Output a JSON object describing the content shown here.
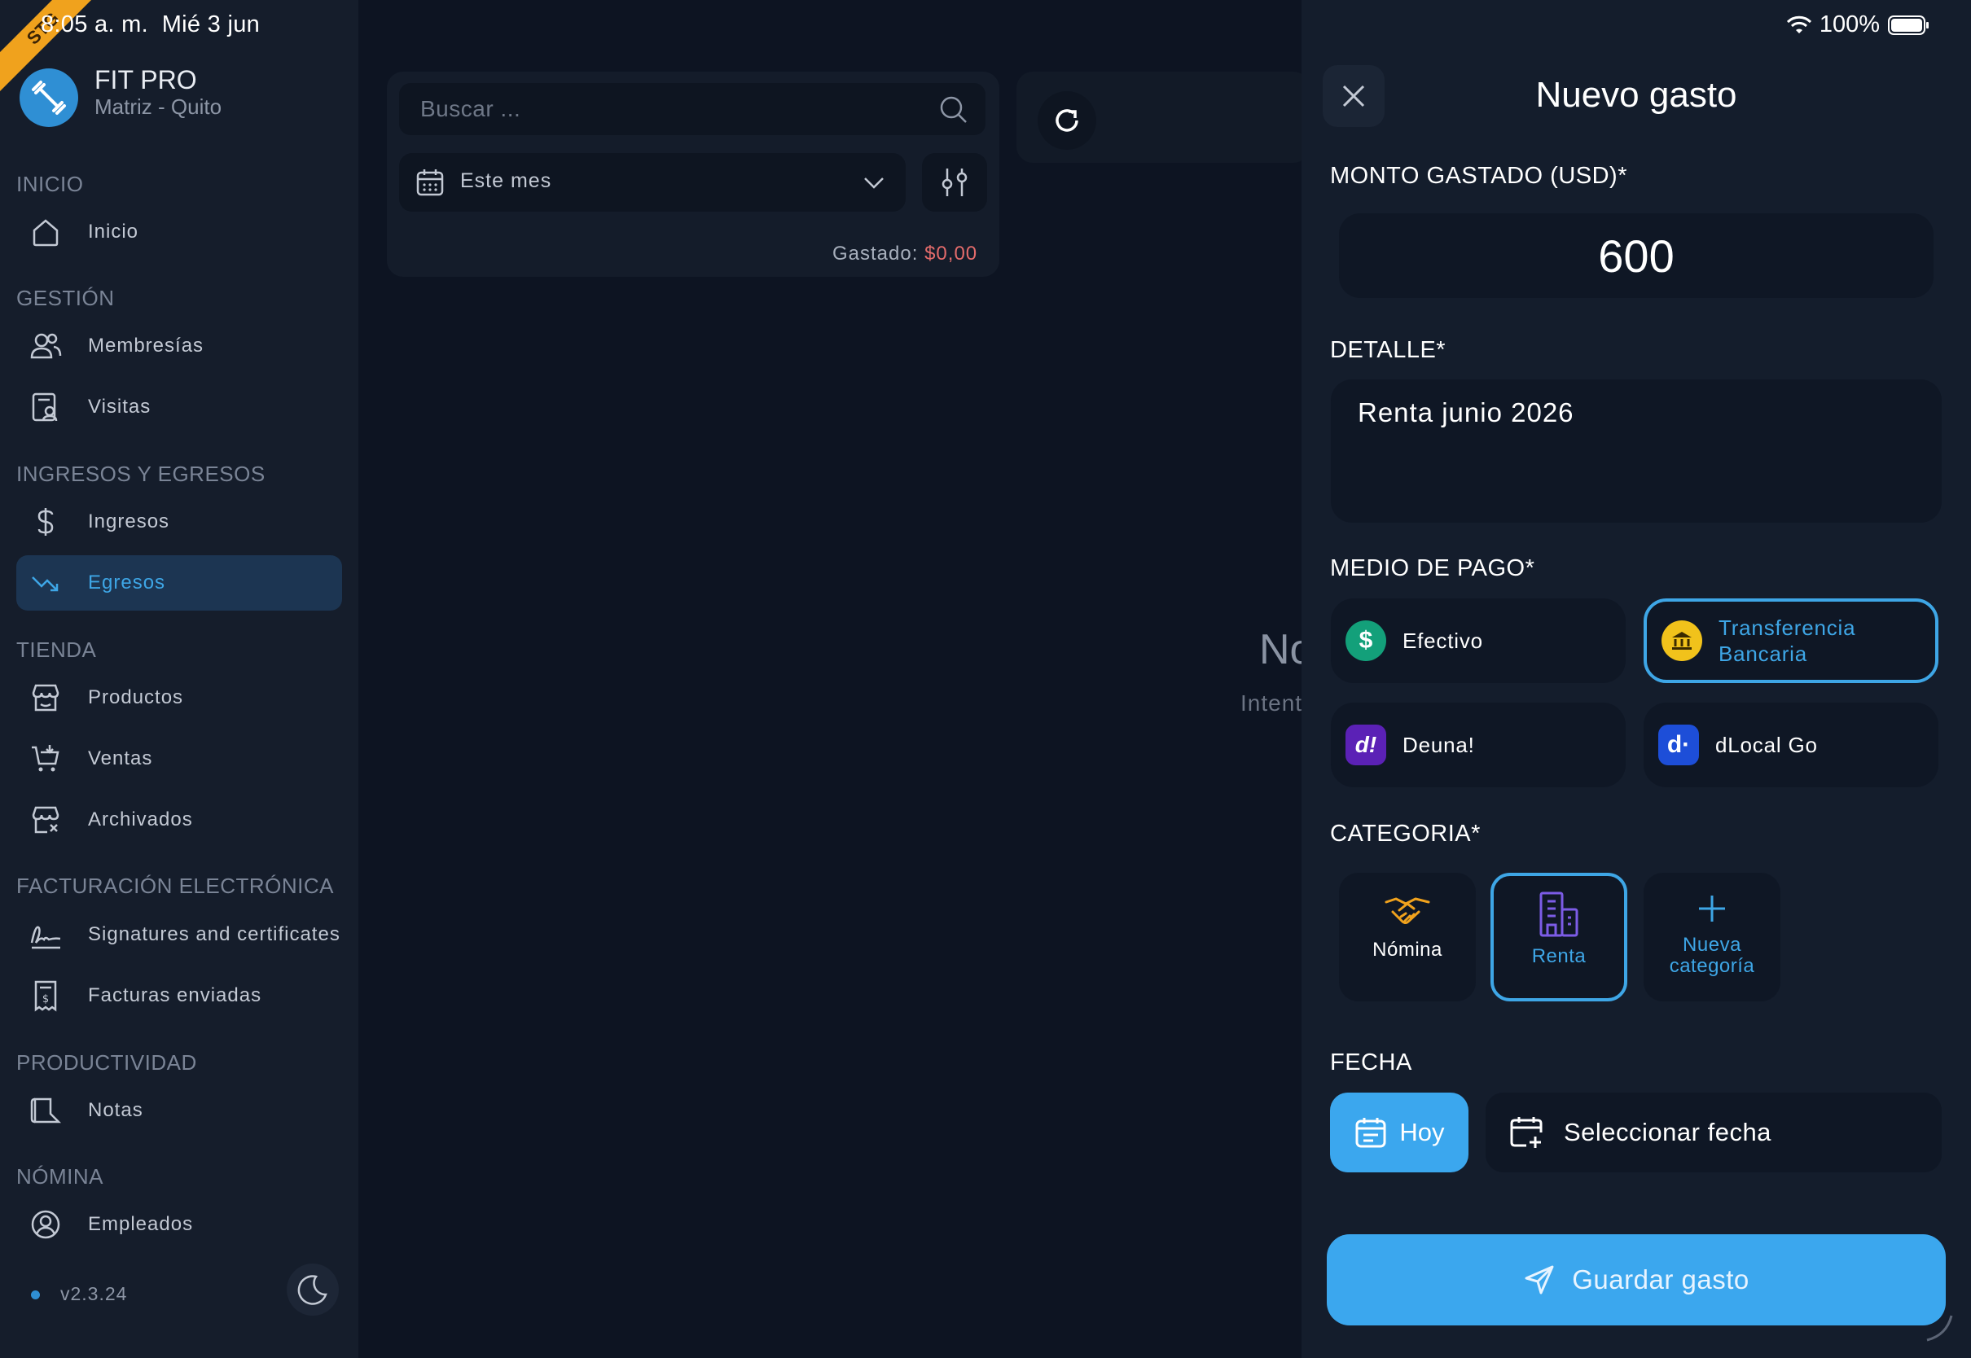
{
  "status_bar": {
    "time": "8:05 a. m.",
    "date": "Mié 3 jun",
    "battery": "100%",
    "env_badge": "STG"
  },
  "sidebar": {
    "brand_title": "FIT PRO",
    "brand_subtitle": "Matriz - Quito",
    "sections": {
      "inicio": "INICIO",
      "gestion": "GESTIÓN",
      "ingresos_egresos": "INGRESOS Y EGRESOS",
      "tienda": "TIENDA",
      "facturacion": "FACTURACIÓN ELECTRÓNICA",
      "productividad": "PRODUCTIVIDAD",
      "nomina": "NÓMINA"
    },
    "items": {
      "inicio": "Inicio",
      "membresias": "Membresías",
      "visitas": "Visitas",
      "ingresos": "Ingresos",
      "egresos": "Egresos",
      "productos": "Productos",
      "ventas": "Ventas",
      "archivados": "Archivados",
      "signatures": "Signatures and certificates",
      "facturas": "Facturas enviadas",
      "notas": "Notas",
      "empleados": "Empleados"
    },
    "version": "v2.3.24",
    "accent": "#3ea6e6"
  },
  "main": {
    "search_placeholder": "Buscar ...",
    "period": "Este mes",
    "spent_label": "Gastado:",
    "spent_value": "$0,00",
    "empty_title_partial": "No",
    "empty_sub_partial": "Intent"
  },
  "panel": {
    "title": "Nuevo gasto",
    "amount_label": "MONTO GASTADO (USD)*",
    "amount_value": "600",
    "detail_label": "DETALLE*",
    "detail_value": "Renta junio 2026",
    "payment_label": "MEDIO DE PAGO*",
    "payment_methods": {
      "efectivo": "Efectivo",
      "transferencia_1": "Transferencia",
      "transferencia_2": "Bancaria",
      "deuna": "Deuna!",
      "dlocal": "dLocal Go"
    },
    "payment_selected": "Transferencia Bancaria",
    "category_label": "CATEGORIA*",
    "categories": {
      "nomina": "Nómina",
      "renta": "Renta",
      "nueva_1": "Nueva",
      "nueva_2": "categoría"
    },
    "category_selected": "Renta",
    "date_label": "FECHA",
    "today": "Hoy",
    "select_date": "Seleccionar fecha",
    "save": "Guardar gasto"
  }
}
